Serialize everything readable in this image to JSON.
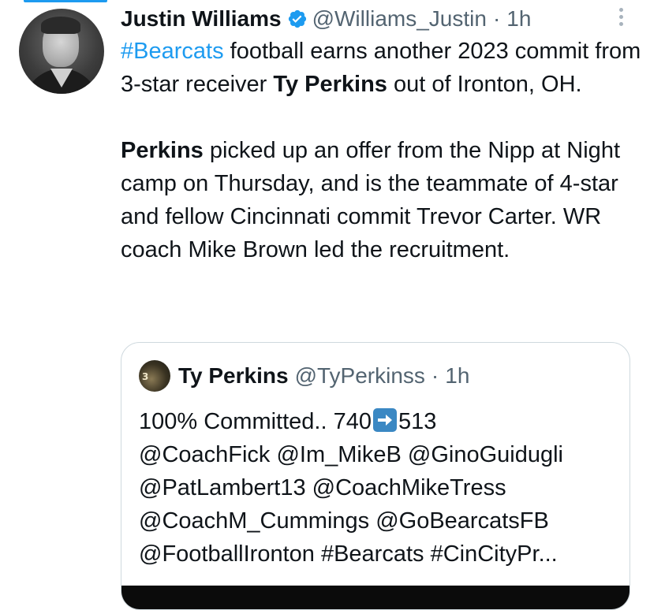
{
  "tweet": {
    "author_name": "Justin Williams",
    "handle": "@Williams_Justin",
    "separator": "·",
    "time": "1h",
    "verified_icon": "verified-badge-icon",
    "avatar_icon": "profile-photo",
    "more_icon": "more-options-icon",
    "p1": {
      "hashtag": "#Bearcats",
      "text1": " football earns another 2023 commit from 3-star receiver ",
      "bold1": "Ty Perkins",
      "text2": " out of Ironton, OH."
    },
    "p2": {
      "bold1": "Perkins",
      "text1": " picked up an offer from the Nipp at Night camp on Thursday, and is the teammate of 4-star and fellow Cincinnati commit Trevor Carter. WR coach Mike Brown led the recruitment."
    }
  },
  "quote": {
    "author_name": "Ty Perkins",
    "handle": "@TyPerkinss",
    "separator": "·",
    "time": "1h",
    "avatar_mark": "3",
    "line1_a": "100% Committed.. 740",
    "arrow_icon": "right-arrow-emoji-icon",
    "line1_b": "513",
    "line2": "@CoachFick @Im_MikeB @GinoGuidugli",
    "line3": "@PatLambert13 @CoachMikeTress",
    "line4": "@CoachM_Cummings @GoBearcatsFB",
    "line5": "@FootballIronton #Bearcats #CinCityPr..."
  },
  "colors": {
    "link": "#1d9bf0",
    "secondary_text": "#536471",
    "primary_text": "#0f1419",
    "border": "#cfd9de",
    "arrow_emoji_bg": "#3b88c3"
  }
}
